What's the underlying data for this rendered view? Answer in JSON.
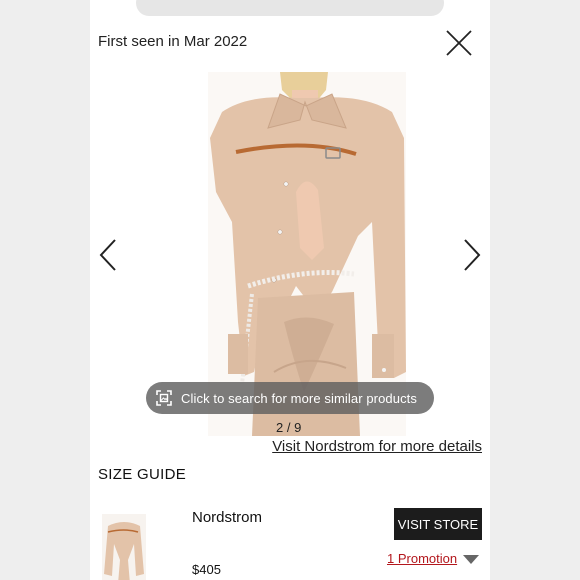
{
  "header": {
    "first_seen": "First seen in Mar 2022"
  },
  "icons": {
    "close": "close-icon",
    "prev": "chevron-left-icon",
    "next": "chevron-right-icon",
    "lens": "image-search-icon",
    "promo_caret": "caret-down-icon"
  },
  "gallery": {
    "lens_label": "Click to search for more similar products",
    "counter": "2 / 9",
    "current_index": 2,
    "total_images": 9,
    "visit_link": "Visit Nordstrom for more details"
  },
  "size_guide": {
    "label": "SIZE GUIDE"
  },
  "offer": {
    "store": "Nordstrom",
    "price": "$405",
    "visit_store_label": "VISIT STORE",
    "promotion_label": "1 Promotion"
  },
  "colors": {
    "background": "#eeeeee",
    "panel": "#ffffff",
    "button_dark": "#1c1c1c",
    "promotion_red": "#b3171d",
    "garment": "#e3c3a9"
  }
}
